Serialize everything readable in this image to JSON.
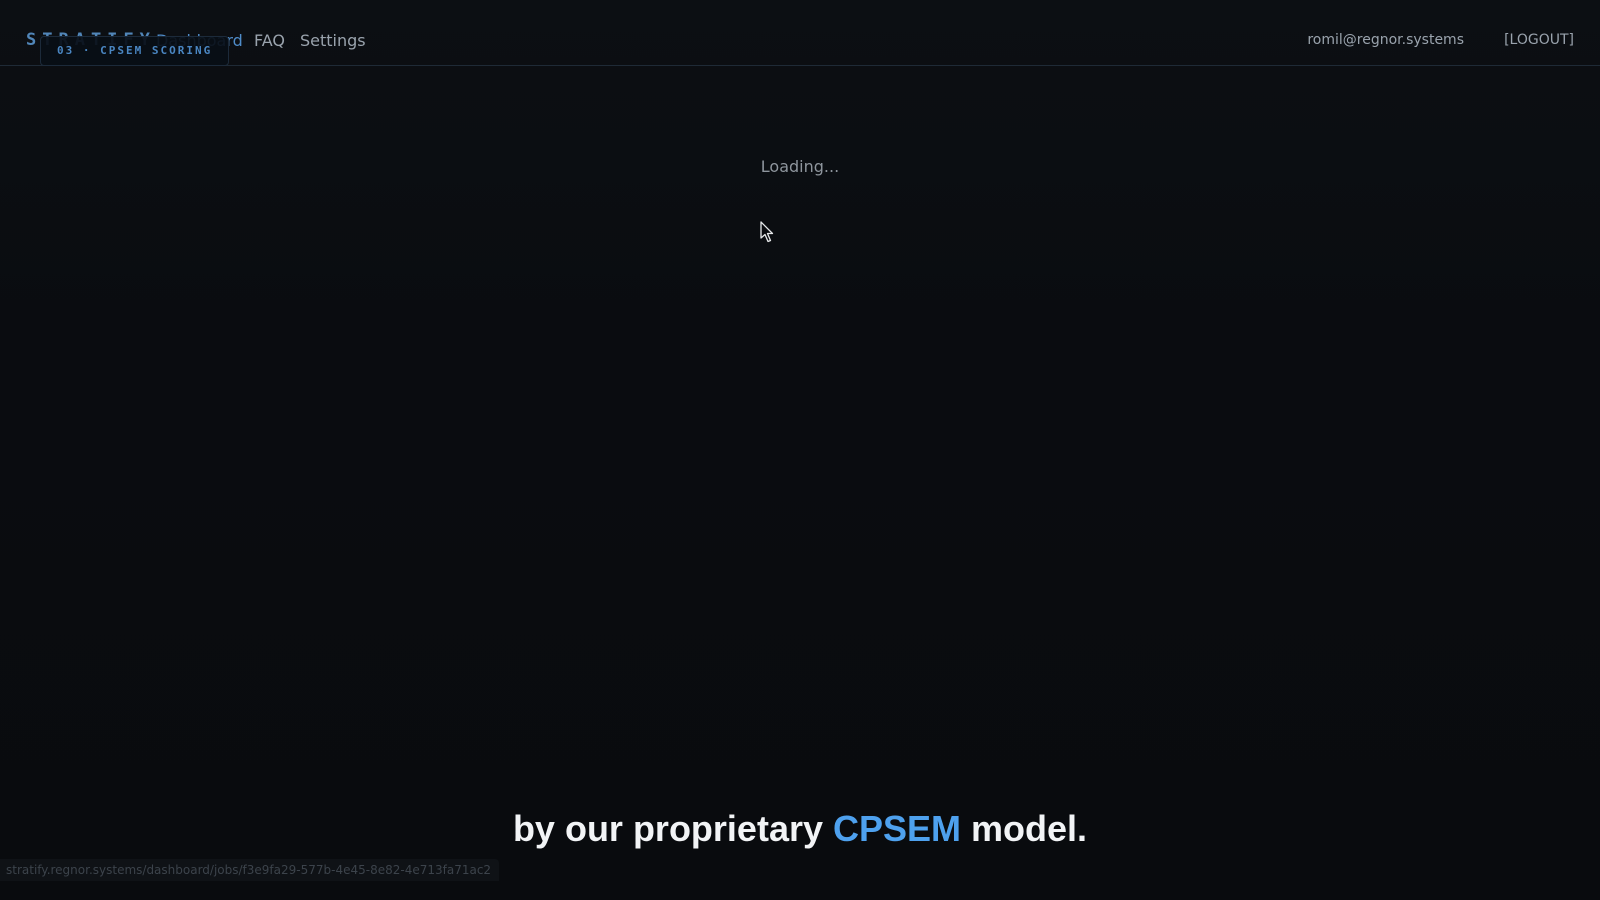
{
  "nav": {
    "brand": "STRATIFY",
    "dashboard_label": "Dashboard",
    "faq_label": "FAQ",
    "settings_label": "Settings",
    "user_email": "romil@regnor.systems",
    "logout_label": "[LOGOUT]"
  },
  "step_badge": "03 · CPSEM SCORING",
  "main": {
    "loading_text": "Loading..."
  },
  "caption": {
    "before": "by our proprietary ",
    "highlight": "CPSEM",
    "after": " model."
  },
  "status_bar": {
    "url": "stratify.regnor.systems/dashboard/jobs/f3e9fa29-577b-4e45-8e82-4e713fa71ac2"
  },
  "colors": {
    "background": "#0a0c10",
    "accent": "#4ea1ee",
    "brand": "#5e9bd6"
  }
}
